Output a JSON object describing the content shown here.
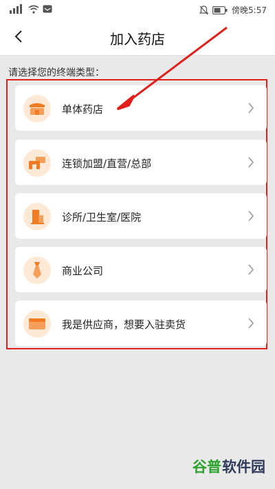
{
  "statusbar": {
    "left_icons": [
      "sim-signal-icon",
      "wifi-icon",
      "message-icon"
    ],
    "time": "傍晚5:57"
  },
  "header": {
    "title": "加入药店"
  },
  "prompt": "请选择您的终端类型：",
  "items": [
    {
      "label": "单体药店",
      "icon": "store-icon"
    },
    {
      "label": "连锁加盟/直营/总部",
      "icon": "chain-store-icon"
    },
    {
      "label": "诊所/卫生室/医院",
      "icon": "clinic-icon"
    },
    {
      "label": "商业公司",
      "icon": "tie-icon"
    },
    {
      "label": "我是供应商，想要入驻卖货",
      "icon": "supplier-box-icon"
    }
  ],
  "colors": {
    "accent": "#f07b22",
    "icon_bg": "#fde9d6",
    "annotation_red": "#e0201a"
  },
  "watermark": {
    "text_a": "谷普",
    "text_b": "软件园"
  }
}
